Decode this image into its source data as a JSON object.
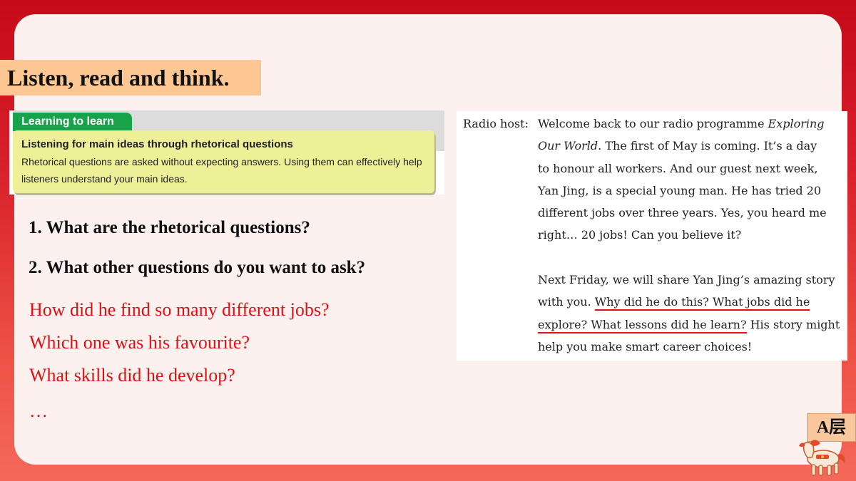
{
  "slide": {
    "title": "Listen, read and think.",
    "learning_box": {
      "tab": "Learning to learn",
      "heading": "Listening for main ideas through rhetorical questions",
      "body": "Rhetorical questions are asked without expecting answers. Using them can effectively help listeners understand your main ideas."
    },
    "questions": [
      "1. What are the rhetorical questions?",
      "2. What other questions do you want to ask?"
    ],
    "answers": [
      "How did he find so many different jobs?",
      "Which one was his favourite?",
      "What skills did he develop?",
      "…"
    ],
    "radio": {
      "speaker": "Radio host:",
      "lines": [
        {
          "a": "Welcome back to our radio programme ",
          "i": "Exploring"
        },
        {
          "i": "Our World",
          "a": ". The first of May is coming. It’s a day"
        },
        {
          "a": "to honour all workers. And our guest next week,"
        },
        {
          "a": "Yan Jing, is a special young man. He has tried 20"
        },
        {
          "a": "different jobs over three years. Yes, you heard me"
        },
        {
          "a": "right… 20 jobs! Can you believe it?"
        },
        {
          "a": ""
        },
        {
          "a": "Next Friday, we will share Yan Jing’s amazing story"
        },
        {
          "a": "with you. ",
          "u": "Why did he do this? What jobs did he"
        },
        {
          "u": "explore? What lessons did he learn?",
          "a": " His story might"
        },
        {
          "a": "help you make smart career choices!"
        }
      ]
    },
    "badge": "A层",
    "colors": {
      "background_top": "#c50a19",
      "background_bottom": "#f4695a",
      "card": "#fdf1f0",
      "title_tag": "#fcc793",
      "answer_text": "#e10f12",
      "underline": "#e10f12",
      "tab_green": "#16a34a",
      "note_yellow": "#eef098"
    },
    "icons": [
      "horse-mascot-icon"
    ]
  }
}
